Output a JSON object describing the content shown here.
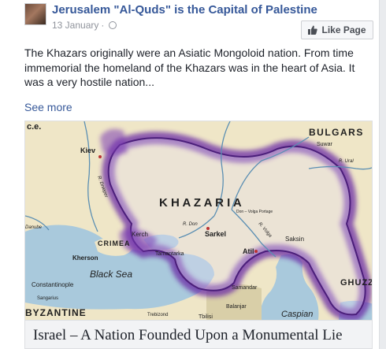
{
  "post": {
    "page_name": "Jerusalem \"Al-Quds\" is the Capital of Palestine",
    "date": "13 January",
    "separator": "·",
    "like_page_label": "Like Page",
    "text": "The Khazars originally were an Asiatic Mongoloid nation. From time immemorial the homeland of the Khazars was in the heart of Asia. It was a very hostile nation...",
    "see_more": "See more"
  },
  "link_preview": {
    "title": "Israel – A Nation Founded Upon a Monumental Lie",
    "map": {
      "labels": {
        "corner": "c.e.",
        "bulgars": "BULGARS",
        "suwar": "Suwar",
        "kiev": "Kiev",
        "khazaria": "K H A Z A R I A",
        "don_volga": "Don – Volga Portage",
        "sarkel": "Sarkel",
        "saksin": "Saksin",
        "atil": "Atil",
        "kerch": "Kerch",
        "tamantarka": "Tamantarka",
        "crimea": "CRIMEA",
        "kherson": "Kherson",
        "black_sea": "Black Sea",
        "constantinople": "Constantinople",
        "sangarius": "Sangarius",
        "byzantine": "BYZANTINE",
        "trebizond": "Trebizond",
        "tbilisi": "Tbilisi",
        "balanjar": "Balanjar",
        "samandar": "Samandar",
        "ghuzz": "GHUZZ",
        "caspian": "Caspian",
        "river_dnieper": "R. Dnieper",
        "river_don": "R. Don",
        "river_volga": "R. Volga",
        "river_ural": "R. Ural",
        "river_danube": "Danube"
      }
    }
  },
  "colors": {
    "link": "#365899",
    "meta": "#90949c",
    "land": "#efe6c7",
    "sea": "#a9c9dc",
    "khazar_border": "#6a2ca5"
  }
}
